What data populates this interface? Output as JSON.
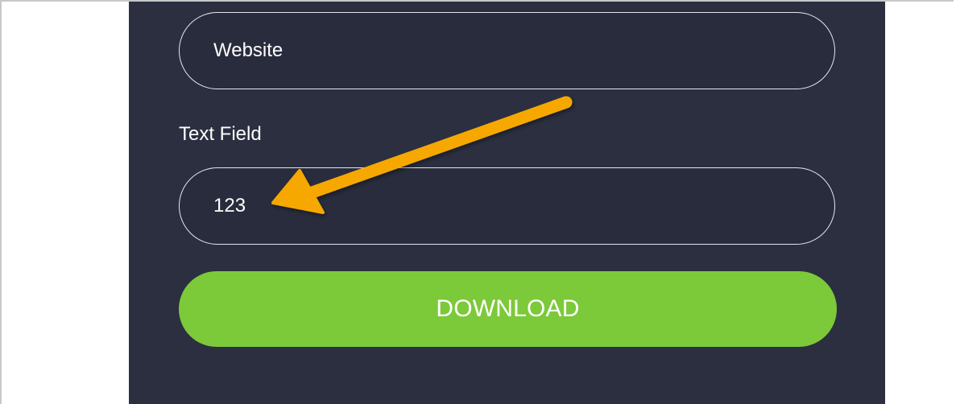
{
  "form": {
    "website_value": "Website",
    "text_field_label": "Text Field",
    "text_field_value": "123",
    "download_label": "DOWNLOAD"
  },
  "colors": {
    "panel_background": "#2b2f40",
    "download_button": "#7cc93a",
    "annotation_arrow": "#f7a800"
  },
  "annotation": {
    "icon": "arrow-icon"
  }
}
